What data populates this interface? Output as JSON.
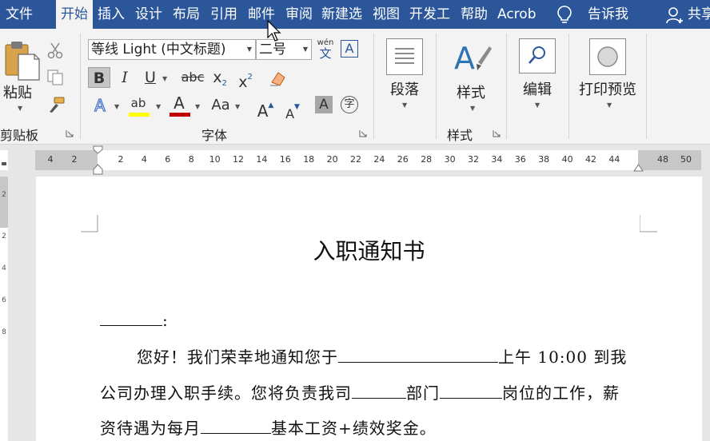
{
  "tabs": [
    "文件",
    "开始",
    "插入",
    "设计",
    "布局",
    "引用",
    "邮件",
    "审阅",
    "新建选",
    "视图",
    "开发工",
    "帮助",
    "Acrob"
  ],
  "active_tab": "开始",
  "tell_me": "告诉我",
  "share": "共享",
  "ribbon": {
    "clipboard": {
      "paste": "粘贴",
      "group_label": "剪贴板"
    },
    "font": {
      "font_name": "等线 Light (中文标题)",
      "font_size": "二号",
      "phonetic_top": "wén",
      "phonetic_bottom": "文",
      "bordered_a": "A",
      "bold": "B",
      "italic": "I",
      "underline": "U",
      "strike": "abc",
      "subscript": "x",
      "subscript_mark": "2",
      "superscript": "x",
      "superscript_mark": "2",
      "text_effect": "A",
      "highlight": "ab",
      "font_color": "A",
      "change_case": "Aa",
      "grow": "A",
      "shrink": "A",
      "char_shading": "A",
      "enclose": "字",
      "group_label": "字体"
    },
    "paragraph": {
      "label": "段落"
    },
    "styles": {
      "label": "样式",
      "group_label": "样式"
    },
    "editing": {
      "label": "编辑"
    },
    "print_preview": {
      "label": "打印预览"
    }
  },
  "ruler": {
    "left_numbers": [
      "4",
      "2"
    ],
    "numbers": [
      "2",
      "4",
      "6",
      "8",
      "10",
      "12",
      "14",
      "16",
      "18",
      "20",
      "22",
      "24",
      "26",
      "28",
      "30",
      "32",
      "34",
      "36",
      "38",
      "40",
      "42",
      "44"
    ],
    "right_numbers": [
      "48",
      "50"
    ]
  },
  "vruler_numbers": [
    "2",
    "2",
    "4",
    "6",
    "8"
  ],
  "document": {
    "title": "入职通知书",
    "salutation_suffix": ":",
    "p1_a": "您好！我们荣幸地通知您于",
    "p1_b": "上午 10:00 到我",
    "p2_a": "公司办理入职手续。您将负责我司",
    "p2_b": "部门",
    "p2_c": "岗位的工作，薪",
    "p3_a": "资待遇为每月",
    "p3_b": "基本工资+绩效奖金。"
  },
  "colors": {
    "brand": "#2b579a",
    "highlight_yellow": "#ffff00",
    "font_red": "#c00000",
    "text_effect_blue": "#4472c4"
  }
}
